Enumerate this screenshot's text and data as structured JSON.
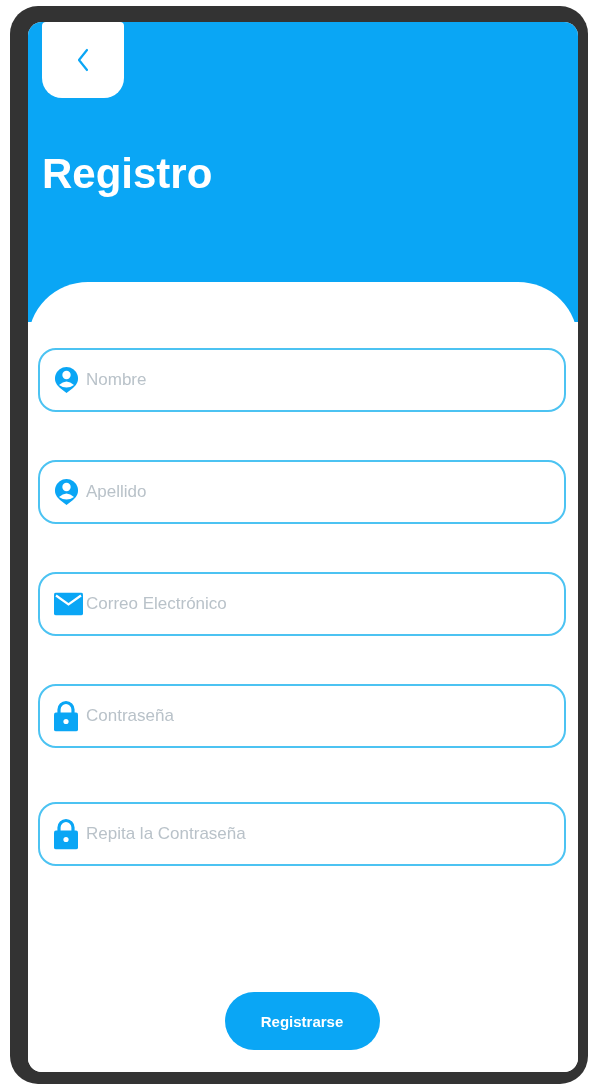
{
  "header": {
    "title": "Registro"
  },
  "fields": [
    {
      "kind": "person",
      "placeholder": "Nombre"
    },
    {
      "kind": "person",
      "placeholder": "Apellido"
    },
    {
      "kind": "mail",
      "placeholder": "Correo Electrónico"
    },
    {
      "kind": "lock",
      "placeholder": "Contraseña"
    },
    {
      "kind": "lock",
      "placeholder": "Repita la Contraseña"
    }
  ],
  "submit_button": "Registrarse"
}
